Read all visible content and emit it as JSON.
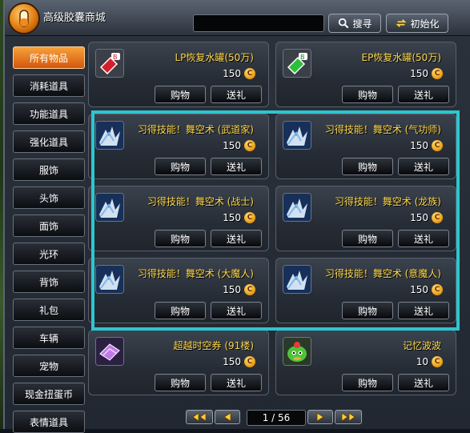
{
  "header": {
    "title": "高级胶囊商城",
    "search": {
      "value": "",
      "placeholder": ""
    },
    "search_button": "搜寻",
    "reset_button": "初始化"
  },
  "sidebar": {
    "items": [
      {
        "label": "所有物品",
        "active": true
      },
      {
        "label": "消耗道具"
      },
      {
        "label": "功能道具"
      },
      {
        "label": "强化道具"
      },
      {
        "label": "服饰"
      },
      {
        "label": "头饰"
      },
      {
        "label": "面饰"
      },
      {
        "label": "光环"
      },
      {
        "label": "背饰"
      },
      {
        "label": "礼包"
      },
      {
        "label": "车辆"
      },
      {
        "label": "宠物"
      },
      {
        "label": "现金扭蛋币"
      },
      {
        "label": "表情道具"
      }
    ]
  },
  "items": [
    {
      "name": "LP恢复水罐(50万)",
      "price": "150",
      "coin": "C",
      "icon": "lp-potion-icon",
      "buy": "购物",
      "gift": "送礼"
    },
    {
      "name": "EP恢复水罐(50万)",
      "price": "150",
      "coin": "C",
      "icon": "ep-potion-icon",
      "buy": "购物",
      "gift": "送礼"
    },
    {
      "name": "习得技能！舞空术 (武道家)",
      "price": "150",
      "coin": "C",
      "icon": "skill-scroll-icon",
      "buy": "购物",
      "gift": "送礼"
    },
    {
      "name": "习得技能！舞空术 (气功师)",
      "price": "150",
      "coin": "C",
      "icon": "skill-scroll-icon",
      "buy": "购物",
      "gift": "送礼"
    },
    {
      "name": "习得技能！舞空术 (战士)",
      "price": "150",
      "coin": "C",
      "icon": "skill-scroll-icon",
      "buy": "购物",
      "gift": "送礼"
    },
    {
      "name": "习得技能！舞空术 (龙族)",
      "price": "150",
      "coin": "C",
      "icon": "skill-scroll-icon",
      "buy": "购物",
      "gift": "送礼"
    },
    {
      "name": "习得技能！舞空术 (大魔人)",
      "price": "150",
      "coin": "C",
      "icon": "skill-scroll-icon",
      "buy": "购物",
      "gift": "送礼"
    },
    {
      "name": "习得技能！舞空术 (意魔人)",
      "price": "150",
      "coin": "C",
      "icon": "skill-scroll-icon",
      "buy": "购物",
      "gift": "送礼"
    },
    {
      "name": "超越时空券 (91楼)",
      "price": "150",
      "coin": "C",
      "icon": "ticket-icon",
      "buy": "购物",
      "gift": "送礼"
    },
    {
      "name": "记忆波波",
      "price": "10",
      "coin": "C",
      "icon": "memory-pet-icon",
      "buy": "购物",
      "gift": "送礼"
    }
  ],
  "pagination": {
    "indicator": "1 / 56"
  },
  "colors": {
    "highlight": "#2ec6cf",
    "active_tab": "#e8801f",
    "item_name": "#ffd84a"
  }
}
